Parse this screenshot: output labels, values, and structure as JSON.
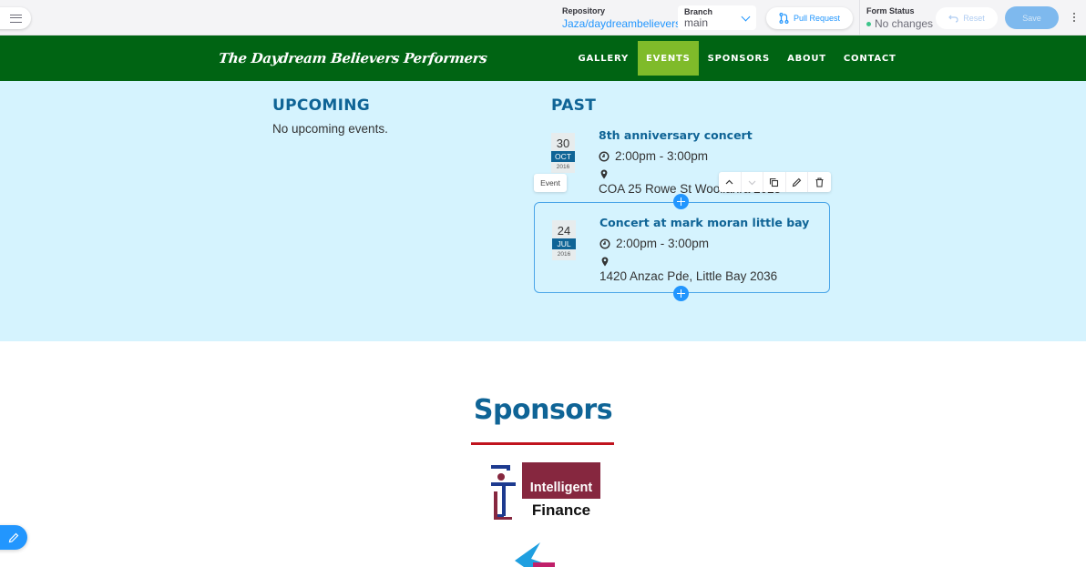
{
  "cms": {
    "repository_label": "Repository",
    "repository_value": "Jaza/daydreambelievers",
    "branch_label": "Branch",
    "branch_value": "main",
    "pull_request_label": "Pull Request",
    "form_status_label": "Form Status",
    "form_status_value": "No changes",
    "reset_label": "Reset",
    "save_label": "Save",
    "accent_color": "#2296fe"
  },
  "site": {
    "logo_text": "The Daydream Believers Performers",
    "nav": [
      {
        "label": "GALLERY",
        "active": false
      },
      {
        "label": "EVENTS",
        "active": true
      },
      {
        "label": "SPONSORS",
        "active": false
      },
      {
        "label": "ABOUT",
        "active": false
      },
      {
        "label": "CONTACT",
        "active": false
      }
    ],
    "nav_bg_color": "#006413",
    "nav_active_color": "#7fbb2a"
  },
  "events": {
    "upcoming_title": "UPCOMING",
    "upcoming_empty": "No upcoming events.",
    "past_title": "PAST",
    "block_label": "Event",
    "past": [
      {
        "day": "30",
        "month": "OCT",
        "year": "2016",
        "title": "8th anniversary concert",
        "time": "2:00pm - 3:00pm",
        "address": "COA 25 Rowe St Woollahra 2025"
      },
      {
        "day": "24",
        "month": "JUL",
        "year": "2016",
        "title": "Concert at mark moran little bay",
        "time": "2:00pm - 3:00pm",
        "address": "1420 Anzac Pde, Little Bay 2036"
      }
    ],
    "block_toolbar": [
      "move-up",
      "move-down",
      "duplicate",
      "edit",
      "delete"
    ]
  },
  "sponsors": {
    "title": "Sponsors",
    "logos": [
      {
        "name": "Intelligent Finance",
        "line1": "Intelligent",
        "line2": "Finance"
      }
    ]
  }
}
